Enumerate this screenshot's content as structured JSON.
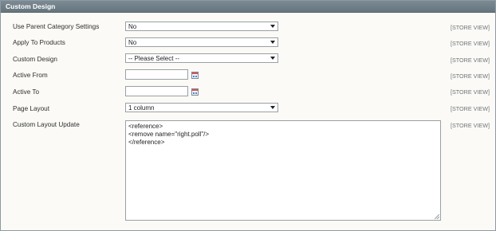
{
  "section": {
    "title": "Custom Design"
  },
  "fields": {
    "use_parent": {
      "label": "Use Parent Category Settings",
      "value": "No",
      "scope": "[STORE VIEW]"
    },
    "apply_to_products": {
      "label": "Apply To Products",
      "value": "No",
      "scope": "[STORE VIEW]"
    },
    "custom_design": {
      "label": "Custom Design",
      "value": "-- Please Select --",
      "scope": "[STORE VIEW]"
    },
    "active_from": {
      "label": "Active From",
      "value": "",
      "scope": "[STORE VIEW]"
    },
    "active_to": {
      "label": "Active To",
      "value": "",
      "scope": "[STORE VIEW]"
    },
    "page_layout": {
      "label": "Page Layout",
      "value": "1 column",
      "scope": "[STORE VIEW]"
    },
    "custom_layout_update": {
      "label": "Custom Layout Update",
      "value": "<reference>\n<remove name=\"right.poll\"/>\n</reference>",
      "scope": "[STORE VIEW]"
    }
  },
  "icons": {
    "calendar": "calendar-icon",
    "dropdown": "chevron-down-icon"
  }
}
